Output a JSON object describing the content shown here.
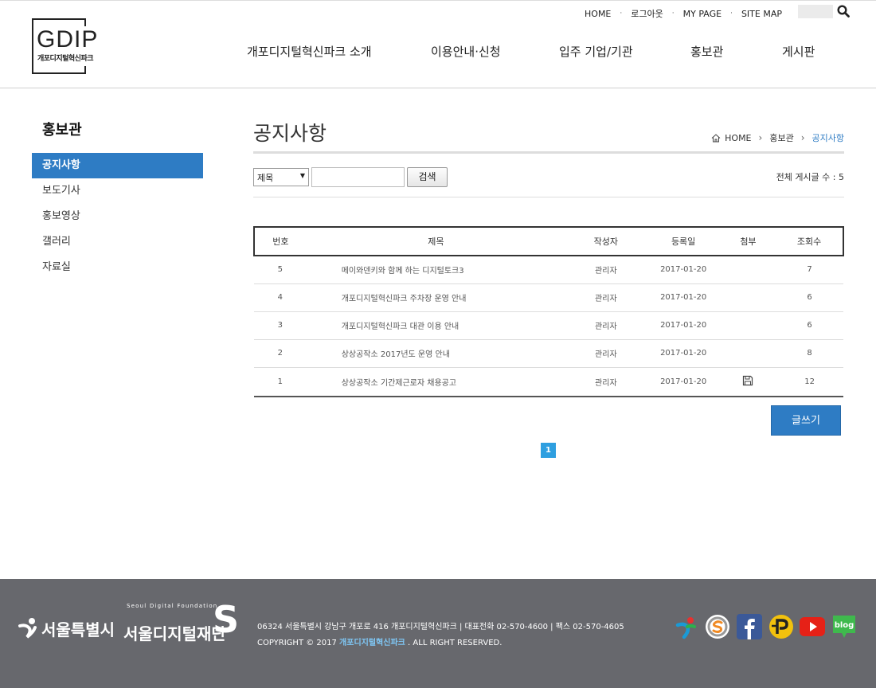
{
  "header": {
    "logo": {
      "text": "GDIP",
      "subtext": "개포디지털혁신파크"
    },
    "util_links": [
      "HOME",
      "로그아웃",
      "MY PAGE",
      "SITE MAP"
    ],
    "search_placeholder": "",
    "gnb": [
      "개포디지털혁신파크 소개",
      "이용안내·신청",
      "입주 기업/기관",
      "홍보관",
      "게시판"
    ]
  },
  "sidebar": {
    "title": "홍보관",
    "items": [
      {
        "label": "공지사항",
        "active": true
      },
      {
        "label": "보도기사",
        "active": false
      },
      {
        "label": "홍보영상",
        "active": false
      },
      {
        "label": "갤러리",
        "active": false
      },
      {
        "label": "자료실",
        "active": false
      }
    ]
  },
  "content": {
    "page_title": "공지사항",
    "breadcrumb": [
      "HOME",
      "홍보관",
      "공지사항"
    ],
    "search": {
      "select_value": "제목",
      "input_value": "",
      "button_label": "검색"
    },
    "total_label": "전체 게시글 수 : 5",
    "table": {
      "columns": [
        "번호",
        "제목",
        "작성자",
        "등록일",
        "첨부",
        "조회수"
      ],
      "rows": [
        {
          "no": "5",
          "title": "메이와덴키와 함께 하는 디지털토크3",
          "author": "관리자",
          "date": "2017-01-20",
          "attach": false,
          "views": "7"
        },
        {
          "no": "4",
          "title": "개포디지털혁신파크 주차장 운영 안내",
          "author": "관리자",
          "date": "2017-01-20",
          "attach": false,
          "views": "6"
        },
        {
          "no": "3",
          "title": "개포디지털혁신파크 대관 이용 안내",
          "author": "관리자",
          "date": "2017-01-20",
          "attach": false,
          "views": "6"
        },
        {
          "no": "2",
          "title": "상상공작소 2017년도 운영 안내",
          "author": "관리자",
          "date": "2017-01-20",
          "attach": false,
          "views": "8"
        },
        {
          "no": "1",
          "title": "상상공작소 기간제근로자 채용공고",
          "author": "관리자",
          "date": "2017-01-20",
          "attach": true,
          "views": "12"
        }
      ]
    },
    "write_button": "글쓰기",
    "pagination": [
      "1"
    ]
  },
  "footer": {
    "seoul_logo": "서울특별시",
    "sdf_logo_en": "Seoul Digital Foundation",
    "sdf_logo_ko": "서울디지털재단",
    "sdf_logo_mark": "S",
    "address": "06324 서울특별시 강남구 개포로 416 개포디지털혁신파크 | 대표전화 02-570-4600 | 팩스 02-570-4605",
    "copyright_prefix": "COPYRIGHT © 2017",
    "copyright_brand": "개포디지털혁신파크",
    "copyright_suffix": ". ALL RIGHT RESERVED.",
    "sns": [
      "seoul-icon",
      "circle-s-icon",
      "facebook-icon",
      "p-icon",
      "youtube-icon",
      "blog-icon"
    ],
    "sns_blog_label": "blog"
  },
  "colors": {
    "accent": "#2e7cc4",
    "footer_bg": "#67686d",
    "pager": "#2e9fe0"
  }
}
